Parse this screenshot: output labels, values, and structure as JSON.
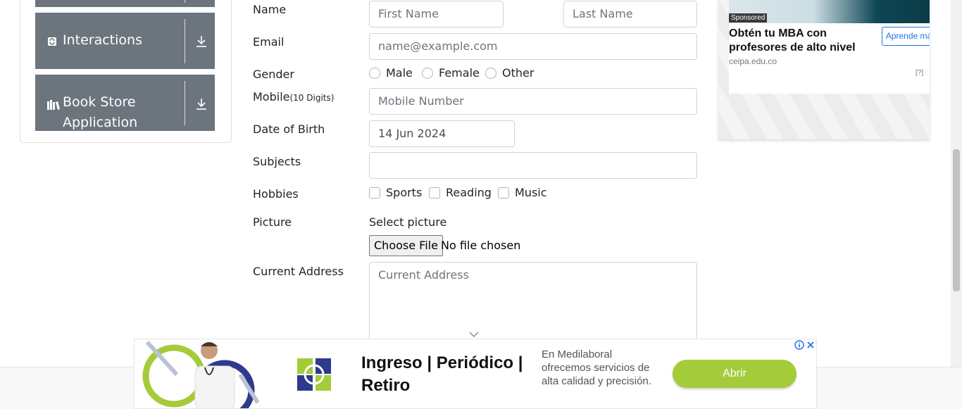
{
  "sidebar": {
    "groups": [
      {
        "label": "Interactions",
        "icon": "refresh-icon"
      },
      {
        "label": "Book Store Application",
        "icon": "books-icon"
      }
    ]
  },
  "form": {
    "name_label": "Name",
    "first_name_placeholder": "First Name",
    "last_name_placeholder": "Last Name",
    "email_label": "Email",
    "email_placeholder": "name@example.com",
    "gender_label": "Gender",
    "gender_options": [
      "Male",
      "Female",
      "Other"
    ],
    "mobile_label": "Mobile",
    "mobile_hint": "(10 Digits)",
    "mobile_placeholder": "Mobile Number",
    "dob_label": "Date of Birth",
    "dob_value": "14 Jun 2024",
    "subjects_label": "Subjects",
    "hobbies_label": "Hobbies",
    "hobbies_options": [
      "Sports",
      "Reading",
      "Music"
    ],
    "picture_label": "Picture",
    "select_picture_text": "Select picture",
    "choose_file_label": "Choose File",
    "file_status": "No file chosen",
    "address_label": "Current Address",
    "address_placeholder": "Current Address"
  },
  "ad_right": {
    "sponsored": "Sponsored",
    "headline": "Obtén tu MBA con profesores de alto nivel",
    "domain": "ceipa.edu.co",
    "cta": "Aprende más",
    "choices": "[?]"
  },
  "ad_bottom": {
    "title": "Ingreso | Periódico | Retiro",
    "description": "En Medilaboral ofrecemos servicios de alta calidad y precisión.",
    "cta": "Abrir"
  },
  "colors": {
    "sidebar_group_bg": "#6c757d",
    "input_border": "#ced4da",
    "ad_cta_green": "#a4cb3a",
    "ad_link_blue": "#1a73e8"
  }
}
